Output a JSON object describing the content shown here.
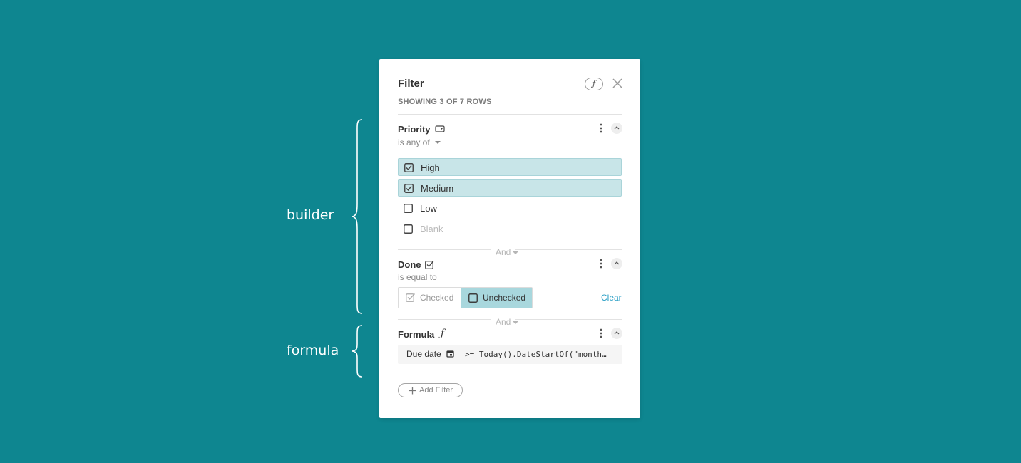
{
  "annotations": {
    "builder_label": "builder",
    "formula_label": "formula"
  },
  "panel": {
    "title": "Filter",
    "subtitle": "SHOWING 3 OF 7 ROWS",
    "formula_toggle_glyph": "ƒ",
    "close_icon": "close-icon"
  },
  "conditions": {
    "priority": {
      "name": "Priority",
      "operator": "is any of",
      "options": [
        {
          "label": "High",
          "checked": true
        },
        {
          "label": "Medium",
          "checked": true
        },
        {
          "label": "Low",
          "checked": false
        },
        {
          "label": "Blank",
          "checked": false
        }
      ]
    },
    "and_1": "And",
    "done": {
      "name": "Done",
      "operator": "is equal to",
      "checked_label": "Checked",
      "unchecked_label": "Unchecked",
      "selected": "Unchecked",
      "clear_label": "Clear"
    },
    "and_2": "And",
    "formula": {
      "name": "Formula",
      "glyph": "ƒ",
      "field_name": "Due date",
      "expression": ">= Today().DateStartOf(\"month…"
    }
  },
  "add_filter_label": "Add Filter",
  "colors": {
    "background": "#0e8690",
    "selected_option": "#c8e5e8",
    "selected_segment": "#a8d7dd",
    "link": "#2a9fc5"
  }
}
